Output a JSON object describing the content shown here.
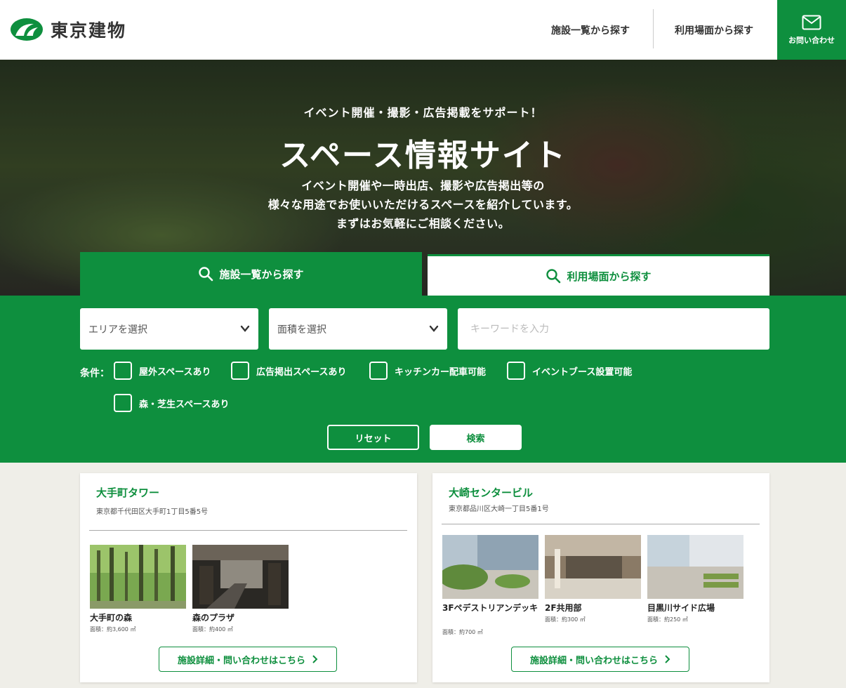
{
  "header": {
    "logo_text": "東京建物",
    "nav": [
      "施設一覧から探す",
      "利用場面から探す"
    ],
    "contact_label": "お問い合わせ",
    "colors": {
      "brand": "#0e8f3e"
    }
  },
  "hero": {
    "subtitle": "イベント開催・撮影・広告掲載をサポート！",
    "title": "スペース情報サイト",
    "description": [
      "イベント開催や一時出店、撮影や広告掲出等の",
      "様々な用途でお使いいただけるスペースを紹介しています。",
      "まずはお気軽にご相談ください。"
    ]
  },
  "tabs": [
    {
      "label": "施設一覧から探す",
      "icon": "search-icon",
      "active": true
    },
    {
      "label": "利用場面から探す",
      "icon": "search-icon",
      "active": false
    }
  ],
  "search": {
    "area_select": "エリアを選択",
    "size_select": "面積を選択",
    "keyword_placeholder": "キーワードを入力",
    "conditions_label": "条件：",
    "conditions": [
      "屋外スペースあり",
      "広告掲出スペースあり",
      "キッチンカー配車可能",
      "イベントブース設置可能",
      "森・芝生スペースあり"
    ],
    "reset_label": "リセット",
    "search_label": "検索"
  },
  "facilities": [
    {
      "name": "大手町タワー",
      "address": "東京都千代田区大手町1丁目5番5号",
      "spaces": [
        {
          "name": "大手町の森",
          "area": "面積：約3,600 ㎡"
        },
        {
          "name": "森のプラザ",
          "area": "面積：約400 ㎡"
        }
      ],
      "detail_label": "施設詳細・問い合わせはこちら"
    },
    {
      "name": "大崎センタービル",
      "address": "東京都品川区大崎一丁目5番1号",
      "spaces": [
        {
          "name": "3Fペデストリアンデッキ",
          "area": "面積：約700 ㎡"
        },
        {
          "name": "2F共用部",
          "area": "面積：約300 ㎡"
        },
        {
          "name": "目黒川サイド広場",
          "area": "面積：約250 ㎡"
        }
      ],
      "detail_label": "施設詳細・問い合わせはこちら"
    }
  ]
}
